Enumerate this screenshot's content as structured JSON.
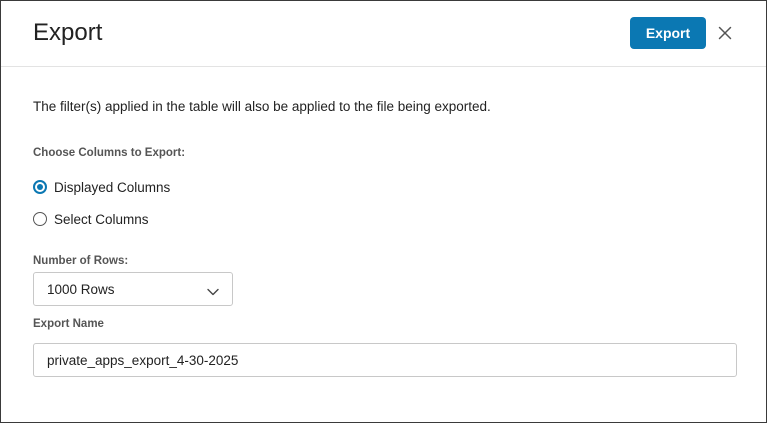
{
  "dialog": {
    "title": "Export",
    "export_button": "Export",
    "close_icon": "close-icon"
  },
  "info_text": "The filter(s) applied in the table will also be applied to the file being exported.",
  "columns": {
    "label": "Choose Columns to Export:",
    "options": [
      {
        "label": "Displayed Columns",
        "checked": true
      },
      {
        "label": "Select Columns",
        "checked": false
      }
    ]
  },
  "rows": {
    "label": "Number of Rows:",
    "selected": "1000 Rows",
    "icon": "chevron-down-icon"
  },
  "export_name": {
    "label": "Export Name",
    "value": "private_apps_export_4-30-2025"
  },
  "colors": {
    "accent": "#0b78b3",
    "border": "#c8c8c8",
    "text": "#222222"
  }
}
